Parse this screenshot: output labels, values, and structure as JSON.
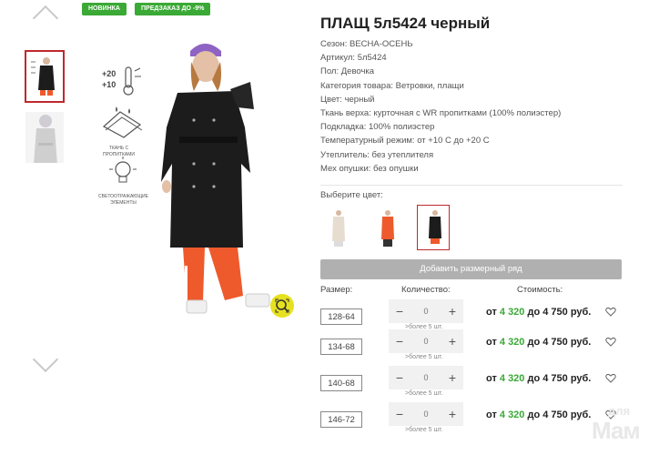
{
  "badges": {
    "new": "НОВИНКА",
    "preorder": "ПРЕДЗАКАЗ ДО -9%"
  },
  "product": {
    "title": "ПЛАЩ 5л5424 черный",
    "specs": [
      "Сезон: ВЕСНА-ОСЕНЬ",
      "Артикул: 5л5424",
      "Пол: Девочка",
      "Категория товара: Ветровки, плащи",
      "Цвет: черный",
      "Ткань верха: курточная с WR пропитками (100% полиэстер)",
      "Подкладка: 100% полиэстер",
      "Температурный режим: от +10 С до +20 С",
      "Утеплитель: без утеплителя",
      "Мех опушки: без опушки"
    ]
  },
  "features": {
    "temp_top": "+20",
    "temp_bottom": "+10",
    "fabric_label": "ТКАНЬ С ПРОПИТКАМИ",
    "reflect_label": "СВЕТООТРАЖАЮЩИЕ ЭЛЕМЕНТЫ"
  },
  "color_select": {
    "label": "Выберите цвет:"
  },
  "add_size_button": "Добавить размерный ряд",
  "table": {
    "headers": {
      "size": "Размер:",
      "qty": "Количество:",
      "cost": "Стоимость:"
    },
    "rows": [
      {
        "size": "128-64",
        "qty": "0",
        "note": ">более 5 шт.",
        "from": "от ",
        "price_low": "4 320",
        "to": " до 4 750 руб."
      },
      {
        "size": "134-68",
        "qty": "0",
        "note": ">более 5 шт.",
        "from": "от ",
        "price_low": "4 320",
        "to": " до 4 750 руб."
      },
      {
        "size": "140-68",
        "qty": "0",
        "note": ">более 5 шт.",
        "from": "от ",
        "price_low": "4 320",
        "to": " до 4 750 руб."
      },
      {
        "size": "146-72",
        "qty": "0",
        "note": ">более 5 шт.",
        "from": "от ",
        "price_low": "4 320",
        "to": " до 4 750 руб."
      }
    ]
  },
  "stepper": {
    "minus": "−",
    "plus": "+"
  },
  "watermark": {
    "top": "для",
    "main": "Мам"
  },
  "colors": {
    "accent_green": "#3aa935",
    "active_red": "#c0282d",
    "coat_black": "#1c1c1c",
    "pants_orange": "#ee5a2b"
  },
  "icons": [
    "chevron-up-icon",
    "chevron-down-icon",
    "zoom-icon",
    "thermometer-icon",
    "fabric-drops-icon",
    "lightbulb-icon",
    "heart-icon"
  ]
}
